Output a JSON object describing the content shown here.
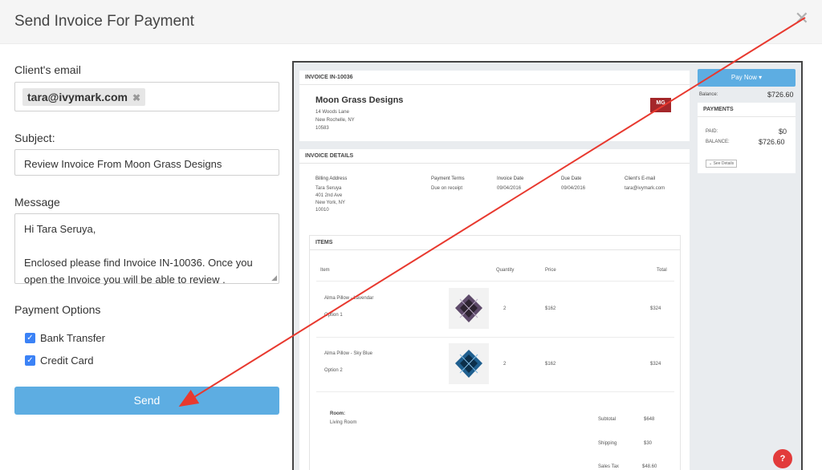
{
  "header": {
    "title": "Send Invoice For Payment",
    "close_glyph": "✕"
  },
  "form": {
    "email_label": "Client's email",
    "email_chip": "tara@ivymark.com",
    "chip_remove": "✖",
    "subject_label": "Subject:",
    "subject_value": "Review Invoice From Moon Grass Designs",
    "message_label": "Message",
    "message_value": "Hi Tara Seruya,\n\nEnclosed please find Invoice IN-10036. Once you open the Invoice you will be able to review .",
    "payment_options_label": "Payment Options",
    "options": [
      {
        "label": "Bank Transfer",
        "checked": true
      },
      {
        "label": "Credit Card",
        "checked": true
      }
    ],
    "send_label": "Send"
  },
  "preview": {
    "invoice_header": "INVOICE IN-10036",
    "company": {
      "name": "Moon Grass Designs",
      "address1": "14 Woods Lane",
      "address2": "New Rochelle, NY",
      "address3": "10583",
      "logo_text": "MG"
    },
    "details_header": "INVOICE DETAILS",
    "details": {
      "billing_label": "Billing Address",
      "billing_name": "Tara Seruya",
      "billing_line1": "401 2nd Ave",
      "billing_line2": "New York, NY",
      "billing_line3": "10010",
      "terms_label": "Payment Terms",
      "terms_value": "Due on receipt",
      "invoice_date_label": "Invoice Date",
      "invoice_date_value": "09/04/2016",
      "due_date_label": "Due Date",
      "due_date_value": "09/04/2016",
      "client_email_label": "Client's E-mail",
      "client_email_value": "tara@ivymark.com"
    },
    "items_header": "ITEMS",
    "columns": {
      "item": "Item",
      "quantity": "Quantity",
      "price": "Price",
      "total": "Total"
    },
    "items": [
      {
        "name": "Alma Pillow - Lavendar",
        "option": "Option 1",
        "qty": "2",
        "price": "$162",
        "total": "$324",
        "color": "#5e4a6a"
      },
      {
        "name": "Alma Pillow - Sky Blue",
        "option": "Option 2",
        "qty": "2",
        "price": "$162",
        "total": "$324",
        "color": "#1f5f8f"
      }
    ],
    "room_label": "Room:",
    "room_value": "Living Room",
    "summary": [
      {
        "label": "Subtotal",
        "value": "$648"
      },
      {
        "label": "Shipping",
        "value": "$30"
      },
      {
        "label": "Sales Tax",
        "value": "$48.60"
      }
    ],
    "pay_now_label": "Pay Now ▾",
    "balance_label": "Balance:",
    "balance_value": "$726.60",
    "payments_header": "PAYMENTS",
    "paid_label": "PAID:",
    "paid_value": "$0",
    "balance2_label": "BALANCE:",
    "balance2_value": "$726.60",
    "see_details_label": "⌄ See Details"
  },
  "help_glyph": "?",
  "colors": {
    "accent": "#5dade2",
    "annotation_arrow": "#e8392f",
    "checkbox": "#3b82f6"
  }
}
